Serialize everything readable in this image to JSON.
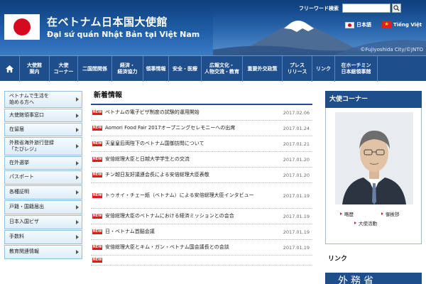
{
  "header": {
    "title_jp": "在ベトナム日本国大使館",
    "title_vn": "Đại sứ quán Nhật Bản tại Việt Nam",
    "photo_credit": "©Fujiyoshida City/©JNTO",
    "search_label": "フリーワード検索",
    "search_value": "",
    "languages": [
      {
        "label": "日本語",
        "flag": "japan-flag"
      },
      {
        "label": "Tiếng Việt",
        "flag": "vietnam-flag"
      }
    ]
  },
  "nav": {
    "items": [
      {
        "label": "大使館\n案内",
        "w": 42
      },
      {
        "label": "大使\nコーナー",
        "w": 40
      },
      {
        "label": "二国間関係",
        "w": 48
      },
      {
        "label": "経済・\n経済協力",
        "w": 44
      },
      {
        "label": "領事情報",
        "w": 36
      },
      {
        "label": "安全・医療",
        "w": 46
      },
      {
        "label": "広報文化・\n人物交流・教育",
        "w": 58
      },
      {
        "label": "重要外交政策",
        "w": 56
      },
      {
        "label": "プレス\nリリース",
        "w": 42
      },
      {
        "label": "リンク",
        "w": 32
      },
      {
        "label": "在ホーチミン\n日本総領事館",
        "w": 60
      }
    ]
  },
  "sidebar": {
    "items": [
      {
        "label": "ベトナムで生活を\n始める方へ",
        "h": 24
      },
      {
        "label": "大使館領事窓口",
        "h": 19
      },
      {
        "label": "在留届",
        "h": 19
      },
      {
        "label": "外務省海外旅行登録\n「たびレジ」",
        "h": 26
      },
      {
        "label": "在外選挙",
        "h": 19
      },
      {
        "label": "パスポート",
        "h": 20
      },
      {
        "label": "各種証明",
        "h": 20
      },
      {
        "label": "戸籍・国籍届出",
        "h": 20
      },
      {
        "label": "日本入国ビザ",
        "h": 20
      },
      {
        "label": "手数料",
        "h": 20
      },
      {
        "label": "教育関連情報",
        "h": 20
      }
    ]
  },
  "news": {
    "title": "新着情報",
    "badge": "NEW",
    "items": [
      {
        "text": "ベトナムの電子ビザ制度の試験的運用開始",
        "date": "2017.02.06",
        "h": 22
      },
      {
        "text": "Aomori Food Fair 2017オープニングセレモニーへの出席",
        "date": "2017.01.24",
        "h": 22
      },
      {
        "text": "天皇皇后両陛下のベトナム国御訪問について",
        "date": "2017.01.21",
        "h": 22
      },
      {
        "text": "安倍総理大臣と日越大学学生との交流",
        "date": "2017.01.20",
        "h": 22
      },
      {
        "text": "チン越日友好議連会長による安倍総理大臣表敬",
        "date": "2017.01.20",
        "h": 22
      },
      {
        "text": "トゥオイ・チェー紙（ベトナム）による安倍総理大臣インタビュー",
        "date": "2017.01.19",
        "h": 36
      },
      {
        "text": "安倍総理大臣のベトナムにおける経済ミッションとの会合",
        "date": "2017.01.19",
        "h": 22
      },
      {
        "text": "日・ベトナム首脳会議",
        "date": "2017.01.19",
        "h": 22
      },
      {
        "text": "安倍総理大臣とキム・ガン・ベトナム国会議長との会談",
        "date": "2017.01.19",
        "h": 22
      },
      {
        "text": "",
        "date": "",
        "h": 14
      }
    ]
  },
  "ambassador": {
    "title": "大使コーナー",
    "links": [
      "略歴",
      "御挨拶",
      "大使活動"
    ]
  },
  "links": {
    "title": "リンク",
    "banner": "外務省"
  },
  "colors": {
    "navy": "#1f4e8c",
    "red": "#d61f1f"
  }
}
